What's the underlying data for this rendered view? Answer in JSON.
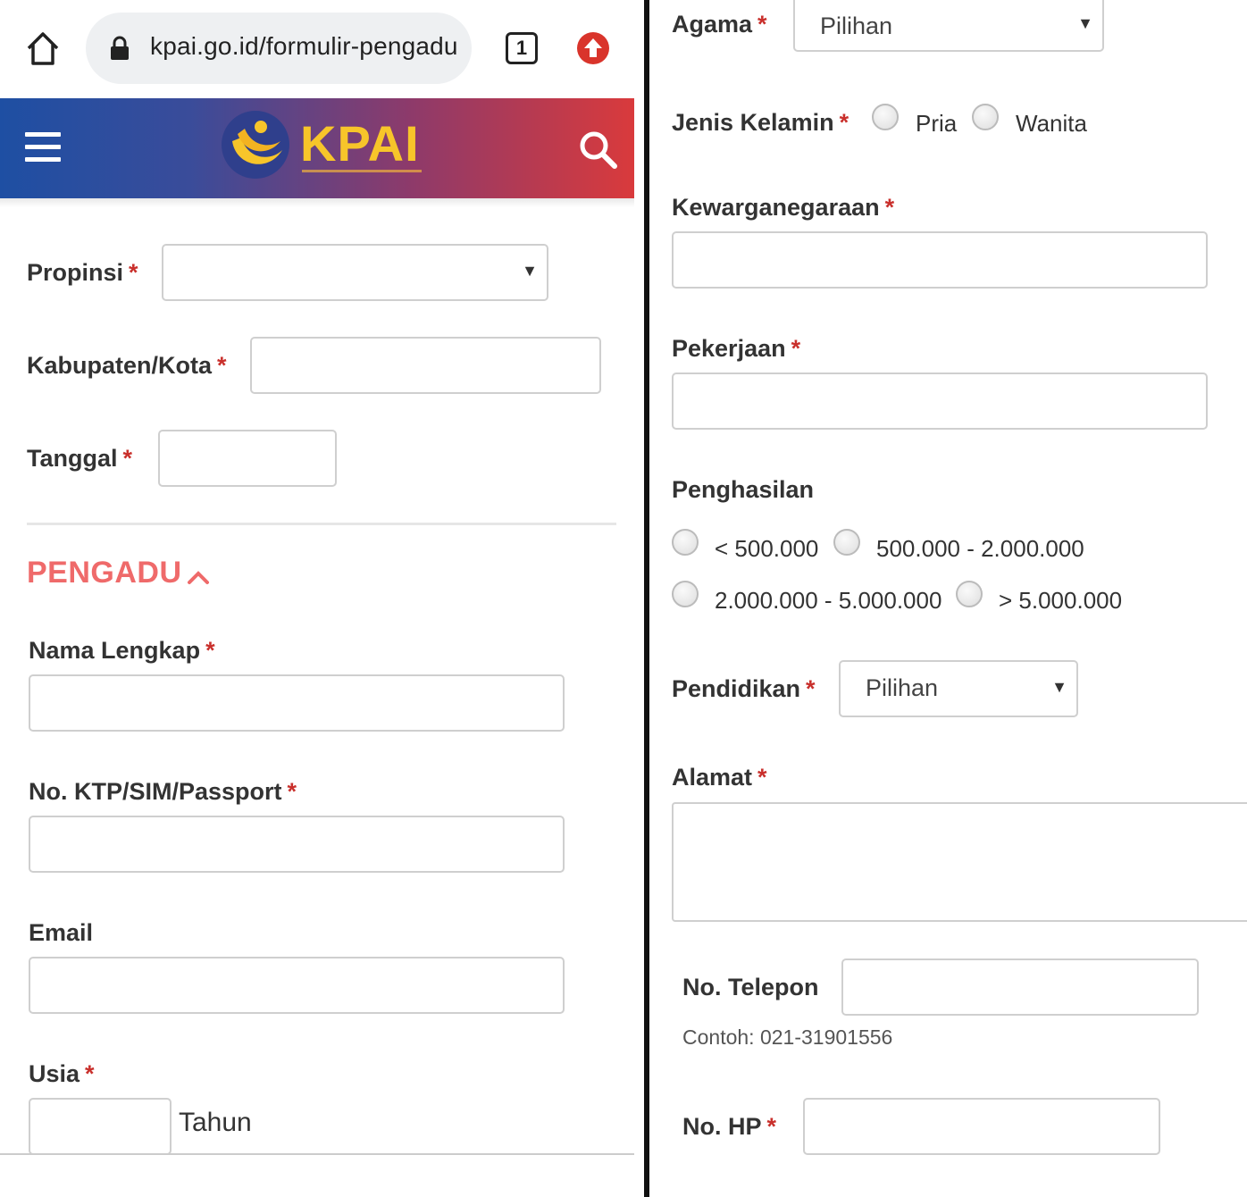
{
  "browser": {
    "url": "kpai.go.id/formulir-pengadu",
    "tab_count": "1"
  },
  "header": {
    "logo_text": "KPAI"
  },
  "form_left": {
    "propinsi_label": "Propinsi",
    "kabupaten_label": "Kabupaten/Kota",
    "tanggal_label": "Tanggal",
    "section_title": "PENGADU",
    "nama_label": "Nama Lengkap",
    "ktp_label": "No. KTP/SIM/Passport",
    "email_label": "Email",
    "usia_label": "Usia",
    "usia_unit": "Tahun"
  },
  "form_right": {
    "agama_label": "Agama",
    "agama_value": "Pilihan",
    "jenis_kelamin_label": "Jenis Kelamin",
    "gender_options": [
      "Pria",
      "Wanita"
    ],
    "kewarganegaraan_label": "Kewarganegaraan",
    "pekerjaan_label": "Pekerjaan",
    "penghasilan_label": "Penghasilan",
    "income_options": [
      "< 500.000",
      "500.000 - 2.000.000",
      "2.000.000 - 5.000.000",
      "> 5.000.000"
    ],
    "pendidikan_label": "Pendidikan",
    "pendidikan_value": "Pilihan",
    "alamat_label": "Alamat",
    "telepon_label": "No. Telepon",
    "telepon_hint": "Contoh: 021-31901556",
    "hp_label": "No. HP"
  },
  "required_mark": "*",
  "colors": {
    "section_accent": "#ef6a6a",
    "required": "#c9302c",
    "logo_yellow": "#f7c52a",
    "header_start": "#1e4fa3",
    "header_end": "#d93a3c"
  }
}
